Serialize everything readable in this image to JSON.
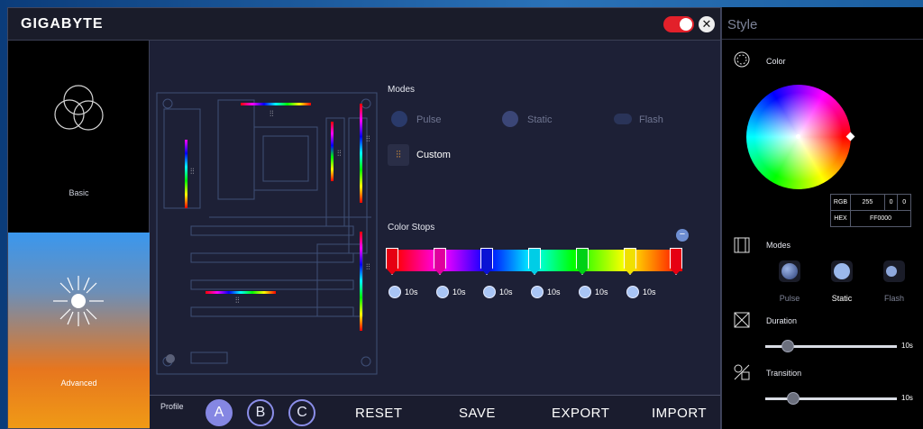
{
  "app": {
    "logo": "GIGABYTE"
  },
  "sidebar": {
    "items": [
      {
        "label": "Basic"
      },
      {
        "label": "Advanced"
      }
    ]
  },
  "modes": {
    "title": "Modes",
    "options": [
      {
        "label": "Pulse"
      },
      {
        "label": "Static"
      },
      {
        "label": "Flash"
      },
      {
        "label": "Custom"
      }
    ]
  },
  "color_stops": {
    "title": "Color Stops",
    "stops": [
      {
        "color": "#ff0000",
        "time": "10s"
      },
      {
        "color": "#ff00ff",
        "time": "10s"
      },
      {
        "color": "#0000ff",
        "time": "10s"
      },
      {
        "color": "#00ffff",
        "time": "10s"
      },
      {
        "color": "#00ff00",
        "time": "10s"
      },
      {
        "color": "#ffff00",
        "time": "10s"
      },
      {
        "color": "#ff0000",
        "time": ""
      }
    ]
  },
  "bottom": {
    "profile_label": "Profile",
    "profiles": [
      "A",
      "B",
      "C"
    ],
    "actions": [
      "RESET",
      "SAVE",
      "EXPORT",
      "IMPORT"
    ]
  },
  "style_panel": {
    "title": "Style",
    "color_label": "Color",
    "rgb_label": "RGB",
    "rgb": [
      "255",
      "0",
      "0"
    ],
    "hex_label": "HEX",
    "hex": "FF0000",
    "modes_label": "Modes",
    "mode_options": [
      "Pulse",
      "Static",
      "Flash"
    ],
    "duration_label": "Duration",
    "duration_value": "10s",
    "transition_label": "Transition",
    "transition_value": "10s"
  },
  "colors": {
    "accent": "#8587e3",
    "power_toggle": "#e3202a"
  }
}
